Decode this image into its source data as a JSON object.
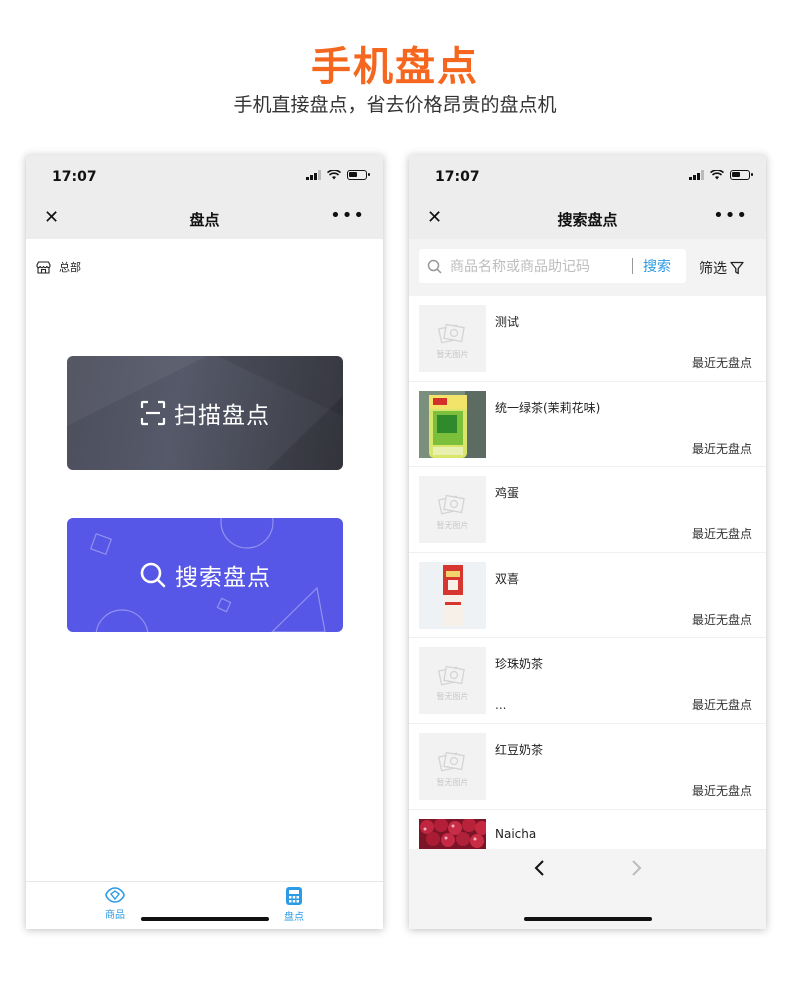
{
  "header": {
    "title": "手机盘点",
    "subtitle": "手机直接盘点，省去价格昂贵的盘点机"
  },
  "left_phone": {
    "status_time": "17:07",
    "nav_title": "盘点",
    "store_label": "总部",
    "scan_button": "扫描盘点",
    "search_button": "搜索盘点",
    "tabs": [
      {
        "label": "商品",
        "icon": "diamond-icon"
      },
      {
        "label": "盘点",
        "icon": "calculator-icon"
      }
    ]
  },
  "right_phone": {
    "status_time": "17:07",
    "nav_title": "搜索盘点",
    "search_placeholder": "商品名称或商品助记码",
    "search_button": "搜索",
    "filter_label": "筛选",
    "no_image_text": "暂无图片",
    "products": [
      {
        "name": "测试",
        "status": "最近无盘点",
        "image": "none",
        "extra": ""
      },
      {
        "name": "统一绿茶(茉莉花味)",
        "status": "最近无盘点",
        "image": "green-tea-bottle",
        "extra": ""
      },
      {
        "name": "鸡蛋",
        "status": "最近无盘点",
        "image": "none",
        "extra": ""
      },
      {
        "name": "双喜",
        "status": "最近无盘点",
        "image": "cigarette-pack",
        "extra": ""
      },
      {
        "name": "珍珠奶茶",
        "status": "最近无盘点",
        "image": "none",
        "extra": "..."
      },
      {
        "name": "红豆奶茶",
        "status": "最近无盘点",
        "image": "none",
        "extra": ""
      },
      {
        "name": "Naicha",
        "status": "",
        "image": "red-berries",
        "extra": ""
      }
    ]
  },
  "colors": {
    "accent_orange": "#f5661e",
    "link_blue": "#2b9be6",
    "search_card": "#5757e7",
    "scan_card": "#4c4e5c"
  }
}
